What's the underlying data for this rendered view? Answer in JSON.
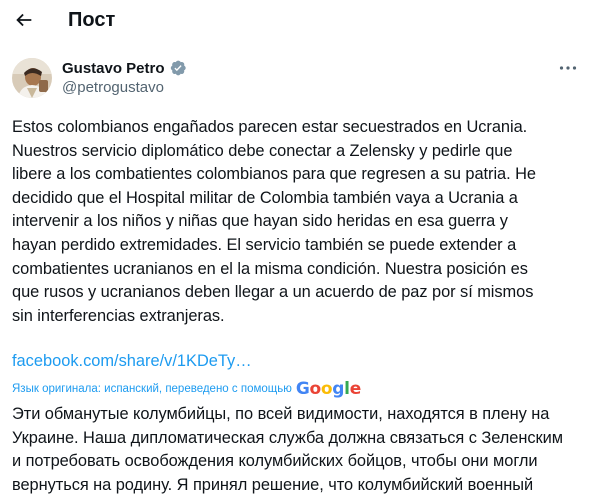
{
  "header": {
    "title": "Пост"
  },
  "post": {
    "author": {
      "name": "Gustavo Petro",
      "handle": "@petrogustavo"
    },
    "text": "Estos colombianos engañados parecen estar secuestrados en Ucrania.\nNuestros servicio diplomático debe conectar a Zelensky y pedirle que\nlibere a los combatientes colombianos para que regresen a su patria. He\ndecidido que el Hospital militar de Colombia también vaya a Ucrania a\nintervenir a los niños y niñas que hayan sido heridas en esa guerra y\nhayan perdido extremidades. El servicio también se puede extender a\ncombatientes ucranianos en el la misma condición. Nuestra posición es\nque rusos y ucranianos deben llegar a un acuerdo de paz por sí mismos\nsin interferencias extranjeras.",
    "link": "facebook.com/share/v/1KDeTy…",
    "translation_note": "Язык оригинала: испанский, переведено с помощью",
    "translation_provider": "Google",
    "translated_text": "Эти обманутые колумбийцы, по всей видимости, находятся в плену на\nУкраине. Наша дипломатическая служба должна связаться с Зеленским\nи потребовать освобождения колумбийских бойцов, чтобы они могли\nвернуться на родину. Я принял решение, что колумбийский военный"
  },
  "colors": {
    "text": "#0f1419",
    "secondary_text": "#536471",
    "link": "#1d9bf0",
    "verified_badge": "#829aab"
  },
  "icons": {
    "back": "arrow-left-icon",
    "verified": "verified-badge-icon",
    "more": "more-horizontal-icon"
  }
}
